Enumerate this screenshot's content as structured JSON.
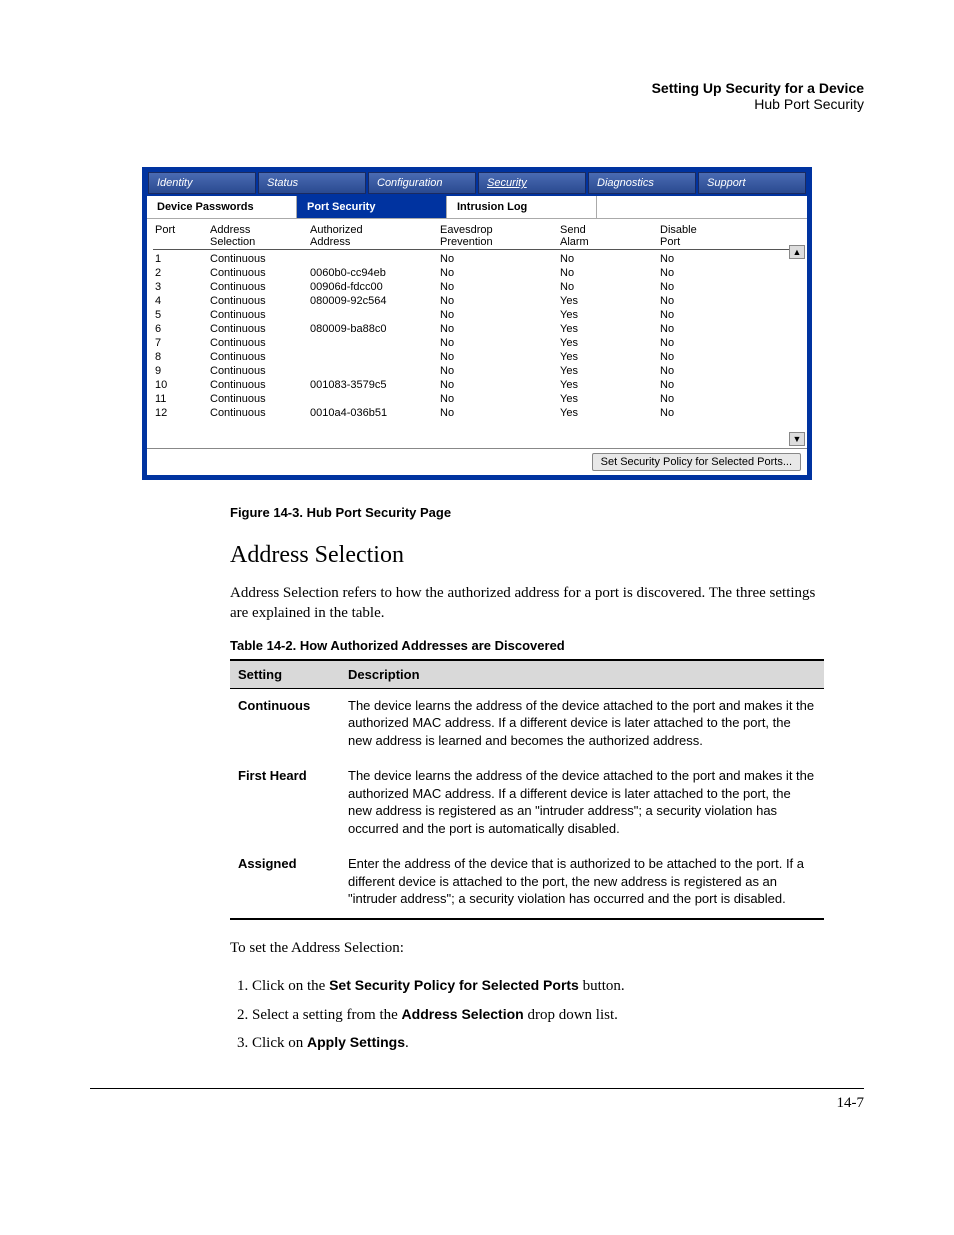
{
  "header": {
    "line1": "Setting Up Security for a Device",
    "line2": "Hub Port Security"
  },
  "panel": {
    "top_tabs": [
      "Identity",
      "Status",
      "Configuration",
      "Security",
      "Diagnostics",
      "Support"
    ],
    "active_top_tab": "Security",
    "sub_tabs": [
      "Device Passwords",
      "Port Security",
      "Intrusion Log"
    ],
    "active_sub_tab": "Port Security",
    "columns": {
      "port": "Port",
      "addr_sel": "Address\nSelection",
      "auth_addr": "Authorized\nAddress",
      "eaves": "Eavesdrop\nPrevention",
      "alarm": "Send\nAlarm",
      "disable": "Disable\nPort"
    },
    "rows": [
      {
        "port": "1",
        "addr": "Continuous",
        "auth": "",
        "eaves": "No",
        "alarm": "No",
        "dis": "No"
      },
      {
        "port": "2",
        "addr": "Continuous",
        "auth": "0060b0-cc94eb",
        "eaves": "No",
        "alarm": "No",
        "dis": "No"
      },
      {
        "port": "3",
        "addr": "Continuous",
        "auth": "00906d-fdcc00",
        "eaves": "No",
        "alarm": "No",
        "dis": "No"
      },
      {
        "port": "4",
        "addr": "Continuous",
        "auth": "080009-92c564",
        "eaves": "No",
        "alarm": "Yes",
        "dis": "No"
      },
      {
        "port": "5",
        "addr": "Continuous",
        "auth": "",
        "eaves": "No",
        "alarm": "Yes",
        "dis": "No"
      },
      {
        "port": "6",
        "addr": "Continuous",
        "auth": "080009-ba88c0",
        "eaves": "No",
        "alarm": "Yes",
        "dis": "No"
      },
      {
        "port": "7",
        "addr": "Continuous",
        "auth": "",
        "eaves": "No",
        "alarm": "Yes",
        "dis": "No"
      },
      {
        "port": "8",
        "addr": "Continuous",
        "auth": "",
        "eaves": "No",
        "alarm": "Yes",
        "dis": "No"
      },
      {
        "port": "9",
        "addr": "Continuous",
        "auth": "",
        "eaves": "No",
        "alarm": "Yes",
        "dis": "No"
      },
      {
        "port": "10",
        "addr": "Continuous",
        "auth": "001083-3579c5",
        "eaves": "No",
        "alarm": "Yes",
        "dis": "No"
      },
      {
        "port": "11",
        "addr": "Continuous",
        "auth": "",
        "eaves": "No",
        "alarm": "Yes",
        "dis": "No"
      },
      {
        "port": "12",
        "addr": "Continuous",
        "auth": "0010a4-036b51",
        "eaves": "No",
        "alarm": "Yes",
        "dis": "No"
      }
    ],
    "button": "Set Security Policy for Selected Ports..."
  },
  "figure_caption": "Figure 14-3. Hub Port Security Page",
  "section_heading": "Address Selection",
  "intro_para": "Address Selection refers to how the authorized address for a port is discovered. The three settings are explained in the table.",
  "table_caption": "Table 14-2.    How Authorized Addresses are Discovered",
  "table_headers": {
    "setting": "Setting",
    "description": "Description"
  },
  "table_rows": [
    {
      "setting": "Continuous",
      "desc": "The device learns the address of the device attached to the port and makes it the authorized MAC address. If a different device is later attached to the port, the new address is learned and becomes the authorized address."
    },
    {
      "setting": "First Heard",
      "desc": "The device learns the address of the device attached to the port and makes it the authorized MAC address. If a different device is later attached to the port, the new address is registered as an \"intruder address\"; a security violation has occurred and the port is automatically disabled."
    },
    {
      "setting": "Assigned",
      "desc": "Enter the address of the device that is authorized to be attached to the port. If a different device is attached to the port, the new address is registered as an \"intruder address\"; a security violation has occurred and the port is disabled."
    }
  ],
  "steps_intro": "To set the Address Selection:",
  "steps": [
    {
      "pre": "Click on the ",
      "bold": "Set Security Policy for Selected Ports",
      "post": " button."
    },
    {
      "pre": "Select a setting from the ",
      "bold": "Address Selection",
      "post": " drop down list."
    },
    {
      "pre": "Click on ",
      "bold": "Apply Settings",
      "post": "."
    }
  ],
  "page_number": "14-7"
}
